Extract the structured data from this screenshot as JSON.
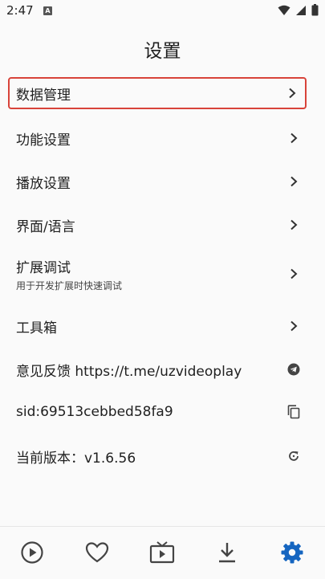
{
  "status_bar": {
    "time": "2:47",
    "notification_badge": "A"
  },
  "header": {
    "title": "设置"
  },
  "settings": [
    {
      "label": "数据管理",
      "trailing_icon": "chevron-right-icon"
    },
    {
      "label": "功能设置",
      "trailing_icon": "chevron-right-icon"
    },
    {
      "label": "播放设置",
      "trailing_icon": "chevron-right-icon"
    },
    {
      "label": "界面/语言",
      "trailing_icon": "chevron-right-icon"
    },
    {
      "label": "扩展调试",
      "subtitle": "用于开发扩展时快速调试",
      "trailing_icon": "chevron-right-icon"
    },
    {
      "label": "工具箱",
      "trailing_icon": "chevron-right-icon"
    },
    {
      "label": "意见反馈 https://t.me/uzvideoplay",
      "trailing_icon": "telegram-icon"
    },
    {
      "label": "sid:69513cebbed58fa9",
      "trailing_icon": "copy-icon"
    },
    {
      "label": "当前版本：v1.6.56",
      "trailing_icon": "refresh-icon"
    }
  ],
  "bottom_nav": [
    "play-icon",
    "heart-icon",
    "tv-icon",
    "download-icon",
    "settings-gear-icon"
  ],
  "colors": {
    "highlight_border": "#d8433a",
    "active_nav": "#1565c0",
    "icon": "#444444"
  }
}
